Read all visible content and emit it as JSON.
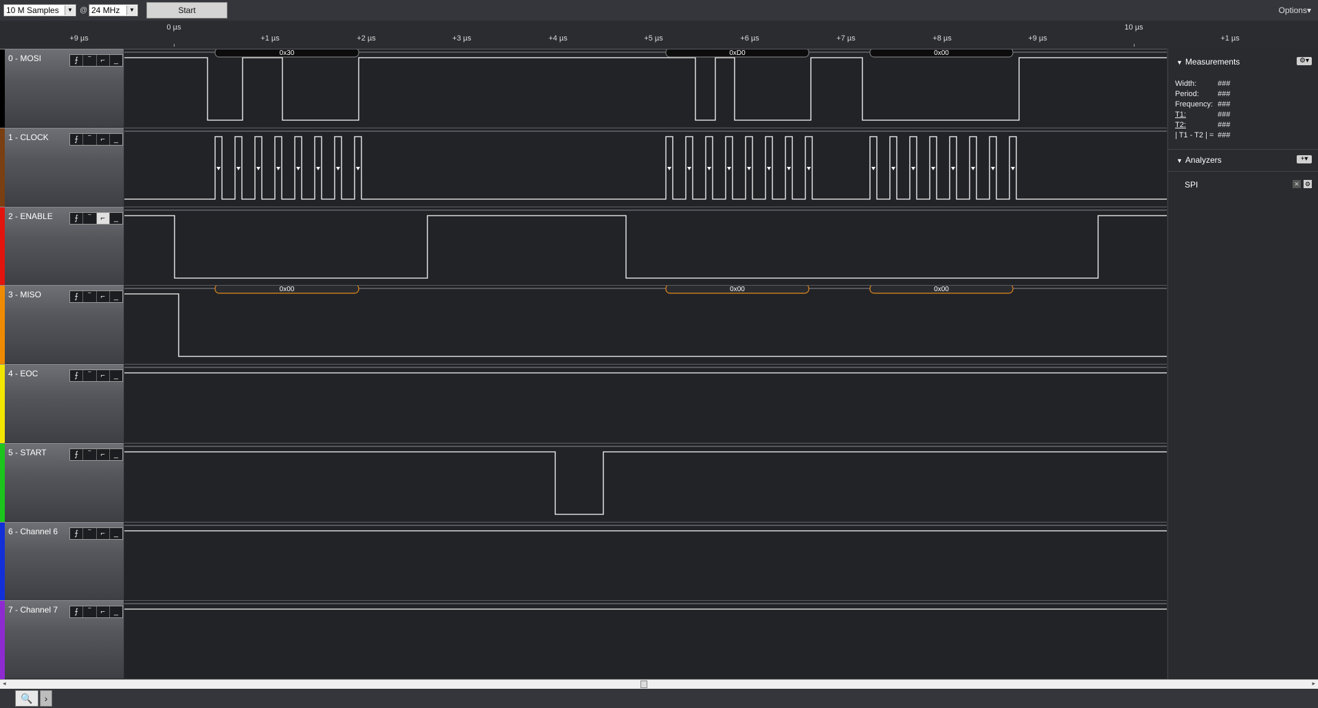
{
  "toolbar": {
    "samples": "10 M Samples",
    "at": "@",
    "rate": "24 MHz",
    "start": "Start",
    "options": "Options▾"
  },
  "ruler": {
    "labels": [
      "+9 µs",
      "0 µs",
      "+1 µs",
      "+2 µs",
      "+3 µs",
      "+4 µs",
      "+5 µs",
      "+6 µs",
      "+7 µs",
      "+8 µs",
      "+9 µs",
      "10 µs",
      "+1 µs"
    ]
  },
  "channels": [
    {
      "name": "0 - MOSI",
      "color": "#000000"
    },
    {
      "name": "1 - CLOCK",
      "color": "#7a3f12"
    },
    {
      "name": "2 - ENABLE",
      "color": "#e3140e"
    },
    {
      "name": "3 - MISO",
      "color": "#f08a00"
    },
    {
      "name": "4 - EOC",
      "color": "#f2e600"
    },
    {
      "name": "5 - START",
      "color": "#1cc51c"
    },
    {
      "name": "6 - Channel 6",
      "color": "#1230d8"
    },
    {
      "name": "7 - Channel 7",
      "color": "#8d2bd0"
    }
  ],
  "trigger_glyphs": [
    "⨍",
    "‾",
    "⌐",
    "_"
  ],
  "decodes": {
    "mosi": [
      "0x30",
      "0xD0",
      "0x00"
    ],
    "miso": [
      "0x00",
      "0x00",
      "0x00"
    ]
  },
  "panel": {
    "measurements_title": "Measurements",
    "measurements": [
      {
        "label": "Width:",
        "value": "###"
      },
      {
        "label": "Period:",
        "value": "###"
      },
      {
        "label": "Frequency:",
        "value": "###"
      },
      {
        "label": "T1:",
        "value": "###"
      },
      {
        "label": "T2:",
        "value": "###"
      },
      {
        "label": "| T1 - T2 | =",
        "value": "###"
      }
    ],
    "analyzers_title": "Analyzers",
    "analyzers": [
      "SPI"
    ]
  },
  "bottom": {
    "search_tab": "🔍",
    "next_tab": "›"
  }
}
